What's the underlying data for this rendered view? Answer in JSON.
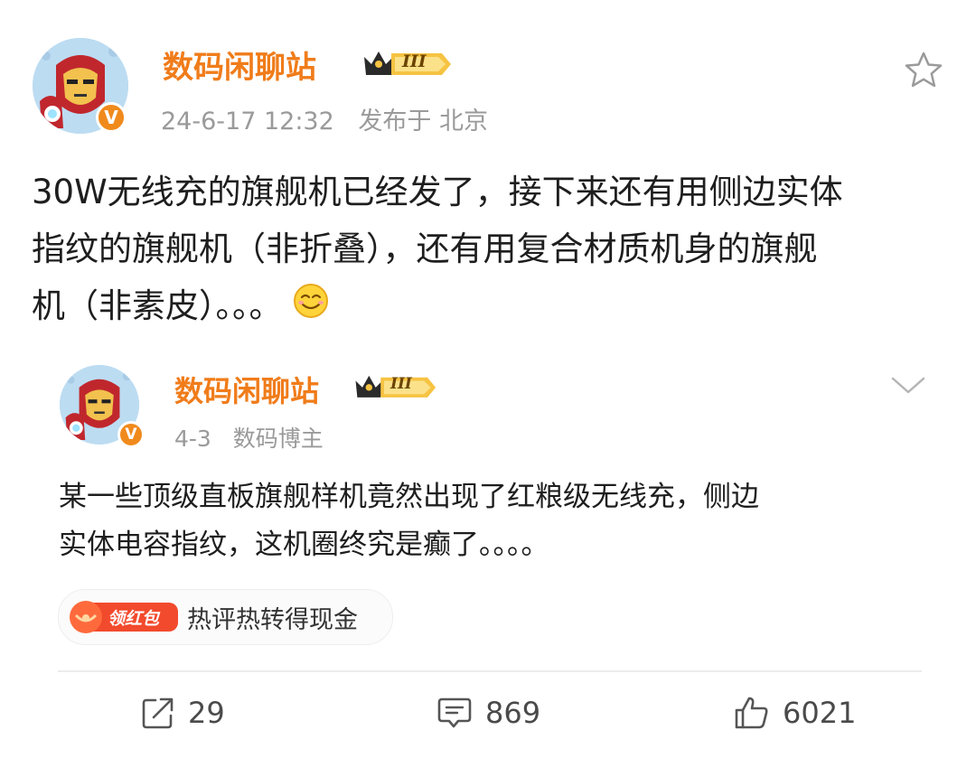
{
  "post": {
    "username": "数码闲聊站",
    "level_badge": "III",
    "meta": "24-6-17 12:32",
    "location": "发布于 北京",
    "verified_mark": "V",
    "text_lines": [
      "30W无线充的旗舰机已经发了，接下来还有用侧边实体",
      "指纹的旗舰机（非折叠），还有用复合材质机身的旗舰",
      "机（非素皮）。。。"
    ]
  },
  "quoted": {
    "username": "数码闲聊站",
    "level_badge": "III",
    "date": "4-3",
    "source": "数码博主",
    "verified_mark": "V",
    "text_lines": [
      "某一些顶级直板旗舰样机竟然出现了红粮级无线充，侧边",
      "实体电容指纹，这机圈终究是癫了。。。。"
    ]
  },
  "red_packet": {
    "badge": "领红包",
    "text": "热评热转得现金"
  },
  "actions": {
    "reposts": "29",
    "comments": "869",
    "likes": "6021"
  },
  "icons": {
    "favorite": "star-outline-icon",
    "expand": "chevron-down-icon",
    "repost": "share-icon",
    "comment": "comment-icon",
    "like": "thumbs-up-icon"
  },
  "colors": {
    "accent": "#f07c1a",
    "meta": "#9a9a9a",
    "red_packet": "#f24a2c"
  }
}
